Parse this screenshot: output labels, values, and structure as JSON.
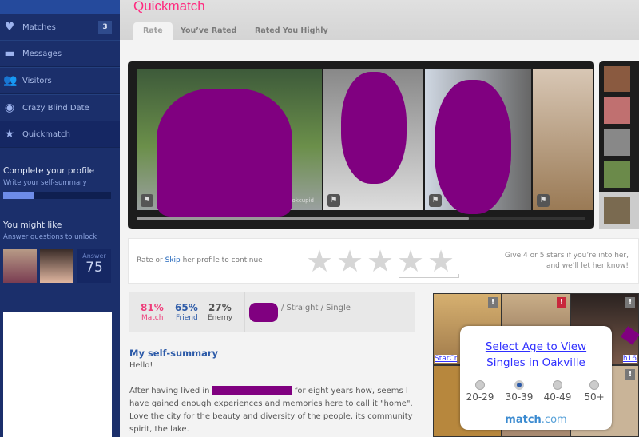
{
  "sidebar": {
    "items": [
      {
        "label": "Matches",
        "icon": "heart-icon",
        "badge": "3"
      },
      {
        "label": "Messages",
        "icon": "speech-bubble-icon"
      },
      {
        "label": "Visitors",
        "icon": "people-icon"
      },
      {
        "label": "Crazy Blind Date",
        "icon": "eye-icon"
      },
      {
        "label": "Quickmatch",
        "icon": "star-icon",
        "selected": true
      }
    ],
    "complete_profile": {
      "title": "Complete your profile",
      "subtitle": "Write your self-summary",
      "progress_percent": 28
    },
    "might_like": {
      "title": "You might like",
      "subtitle": "Answer questions to unlock",
      "answer_label": "Answer",
      "answer_count": "75"
    }
  },
  "header": {
    "title": "Quickmatch",
    "tabs": [
      {
        "label": "Rate",
        "active": true
      },
      {
        "label": "You’ve Rated"
      },
      {
        "label": "Rated You Highly"
      }
    ]
  },
  "photos": {
    "watermark": "okcupid",
    "scroll_percent": 74
  },
  "rating": {
    "prefix": "Rate or ",
    "skip": "Skip",
    "suffix": " her profile to continue",
    "hint_line1": "Give 4 or 5 stars if you’re into her,",
    "hint_line2": "and we’ll let her know!",
    "stars": 5
  },
  "stats": {
    "match_pct": "81%",
    "match_label": "Match",
    "friend_pct": "65%",
    "friend_label": "Friend",
    "enemy_pct": "27%",
    "enemy_label": "Enemy",
    "info": "/ Straight / Single"
  },
  "summary": {
    "heading": "My self-summary",
    "greeting": "Hello!",
    "p1a": "After having lived in",
    "p1b": "for eight years how, seems I have gained enough experiences and memories here to call it \"home\". Love the city for the beauty and diversity of the people, its community spirit, the lake."
  },
  "ad": {
    "usernames": [
      "StarCr",
      "h16"
    ],
    "popup_title": "Select Age to View Singles in Oakville",
    "ages": [
      "20-29",
      "30-39",
      "40-49",
      "50+"
    ],
    "selected_age": "30-39",
    "brand_a": "match",
    "brand_b": ".com"
  },
  "colors": {
    "sidebar": "#1b2f6b",
    "accent_pink": "#ff2a7f",
    "link_blue": "#2255aa",
    "redaction": "#800080"
  }
}
